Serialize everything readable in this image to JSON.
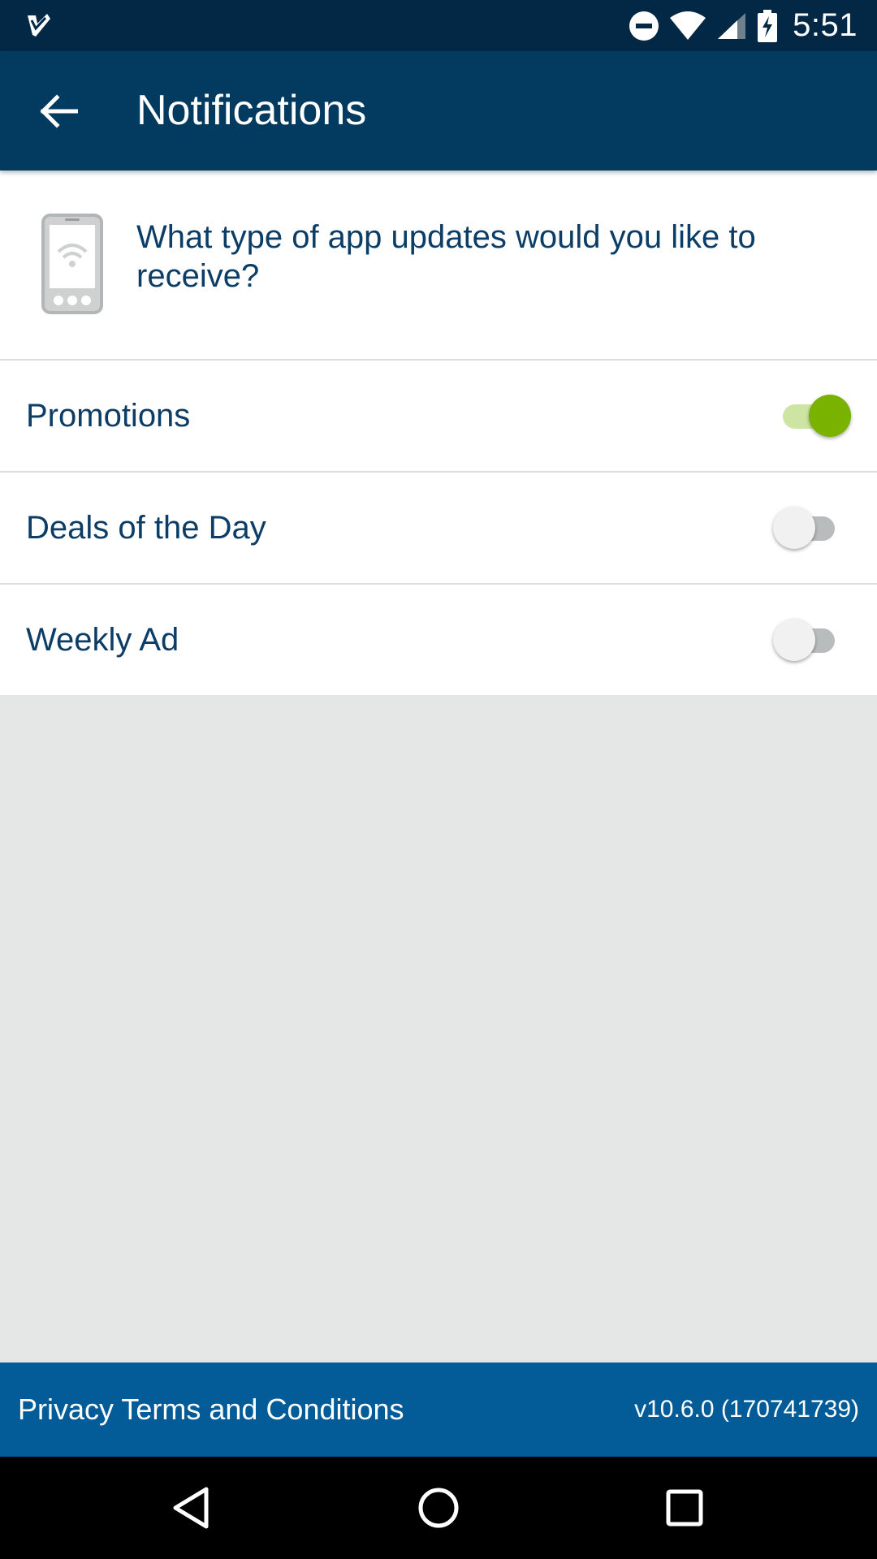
{
  "status_bar": {
    "time": "5:51",
    "icons": [
      "check-app-icon",
      "do-not-disturb-icon",
      "wifi-icon",
      "signal-icon",
      "battery-charging-icon"
    ]
  },
  "toolbar": {
    "back_icon": "arrow-left-icon",
    "title": "Notifications"
  },
  "intro": {
    "icon": "phone-wifi-icon",
    "question": "What type of app updates would you like to receive?"
  },
  "settings": [
    {
      "label": "Promotions",
      "enabled": true
    },
    {
      "label": "Deals of the Day",
      "enabled": false
    },
    {
      "label": "Weekly Ad",
      "enabled": false
    }
  ],
  "footer": {
    "privacy_label": "Privacy Terms and Conditions",
    "version": "v10.6.0 (170741739)"
  },
  "nav_bar": {
    "icons": [
      "back-triangle-icon",
      "home-circle-icon",
      "recents-square-icon"
    ]
  },
  "colors": {
    "status_bar": "#022846",
    "toolbar": "#023a60",
    "text": "#0b3d66",
    "toggle_on": "#7ab200",
    "footer": "#035b97",
    "background": "#e5e7e7"
  }
}
